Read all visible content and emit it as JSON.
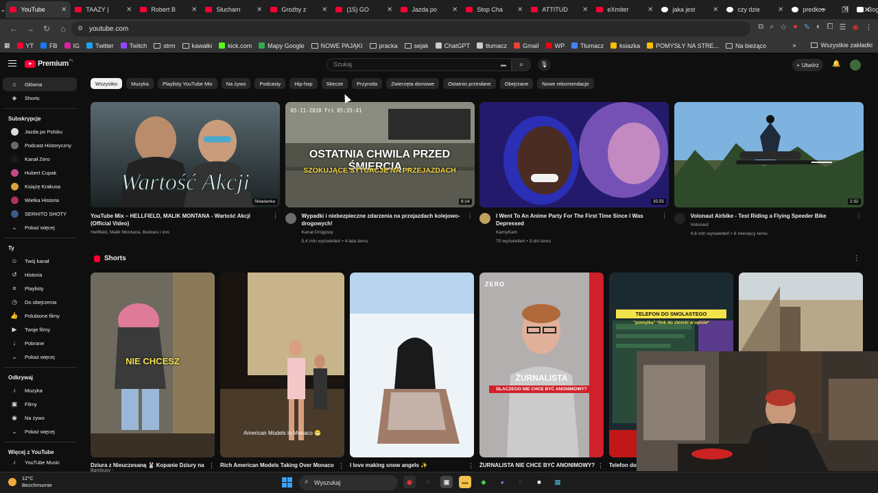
{
  "browser": {
    "tabs": [
      {
        "label": "YouTube",
        "icon": "youtube-icon",
        "active": true
      },
      {
        "label": "TAAZY |",
        "icon": "youtube-icon"
      },
      {
        "label": "Robert B",
        "icon": "youtube-icon"
      },
      {
        "label": "Słucham",
        "icon": "youtube-icon"
      },
      {
        "label": "Groźby z",
        "icon": "youtube-icon"
      },
      {
        "label": "(15) GO",
        "icon": "youtube-icon"
      },
      {
        "label": "Jazda po",
        "icon": "youtube-icon"
      },
      {
        "label": "Stop Cha",
        "icon": "youtube-icon"
      },
      {
        "label": "ATTITUD",
        "icon": "youtube-icon"
      },
      {
        "label": "eXmiter",
        "icon": "youtube-icon"
      },
      {
        "label": "jaka jest",
        "icon": "google-icon"
      },
      {
        "label": "czy dzie",
        "icon": "google-icon"
      },
      {
        "label": "predkos",
        "icon": "google-icon"
      },
      {
        "label": "Bogdan",
        "icon": "wikipedia-icon"
      }
    ],
    "new_tab": "+",
    "url": "youtube.com",
    "bookmarks": [
      {
        "label": "YT",
        "color": "#ff0033"
      },
      {
        "label": "FB",
        "color": "#1877f2"
      },
      {
        "label": "IG",
        "color": "#d6249f"
      },
      {
        "label": "Twitter",
        "color": "#1da1f2"
      },
      {
        "label": "Twitch",
        "color": "#9146ff"
      },
      {
        "label": "strm",
        "folder": true
      },
      {
        "label": "kawałki",
        "folder": true
      },
      {
        "label": "kick.com",
        "color": "#53fc18"
      },
      {
        "label": "Mapy Google",
        "color": "#34a853"
      },
      {
        "label": "NOWE PAJĄKI",
        "folder": true
      },
      {
        "label": "pracka",
        "folder": true
      },
      {
        "label": "sejak",
        "folder": true
      },
      {
        "label": "ChatGPT",
        "color": "#cccccc"
      },
      {
        "label": "tłumacz",
        "color": "#cccccc"
      },
      {
        "label": "Gmail",
        "color": "#ea4335"
      },
      {
        "label": "WP",
        "color": "#e30613"
      },
      {
        "label": "Tłumacz",
        "color": "#4285f4"
      },
      {
        "label": "ksiazka",
        "color": "#fbbc04"
      },
      {
        "label": "POMYSŁY NA STRE...",
        "color": "#fbbc04"
      },
      {
        "label": "Na bieżąco",
        "folder": true
      }
    ],
    "all_bookmarks": "Wszystkie zakładki"
  },
  "yt": {
    "logo_text": "Premium",
    "logo_region": "PL",
    "search_placeholder": "Szukaj",
    "create_label": "Utwórz",
    "sidebar": {
      "main": [
        {
          "label": "Główna",
          "icon": "home-icon",
          "active": true
        },
        {
          "label": "Shorts",
          "icon": "shorts-icon"
        }
      ],
      "subs_header": "Subskrypcje",
      "subs": [
        {
          "label": "Jazda po Polsku",
          "color": "#dddddd"
        },
        {
          "label": "Podcast Historyczny",
          "color": "#6b6b6b"
        },
        {
          "label": "Kanał Zero",
          "color": "#1a1a1a"
        },
        {
          "label": "Hubert Cupak",
          "color": "#c44b8a"
        },
        {
          "label": "Książę Krakusa",
          "color": "#d9a13b"
        },
        {
          "label": "Wielka Historia",
          "color": "#b03060"
        },
        {
          "label": "SERHITO SHOTY",
          "color": "#3b5b8a"
        }
      ],
      "more1": "Pokaż więcej",
      "you_header": "Ty",
      "you": [
        {
          "label": "Twój kanał",
          "icon": "user-icon"
        },
        {
          "label": "Historia",
          "icon": "history-icon"
        },
        {
          "label": "Playlisty",
          "icon": "playlist-icon"
        },
        {
          "label": "Do obejrzenia",
          "icon": "clock-icon"
        },
        {
          "label": "Polubione filmy",
          "icon": "like-icon"
        },
        {
          "label": "Twoje filmy",
          "icon": "video-icon"
        },
        {
          "label": "Pobrane",
          "icon": "download-icon"
        },
        {
          "label": "Pokaż więcej",
          "icon": "chevron-down-icon"
        }
      ],
      "explore_header": "Odkrywaj",
      "explore": [
        {
          "label": "Muzyka",
          "icon": "music-icon"
        },
        {
          "label": "Filmy",
          "icon": "film-icon"
        },
        {
          "label": "Na żywo",
          "icon": "live-icon"
        },
        {
          "label": "Pokaż więcej",
          "icon": "chevron-down-icon"
        }
      ],
      "more_yt_header": "Więcej z YouTube",
      "more_yt_item": "YouTube Music"
    },
    "chips": [
      "Wszystko",
      "Muzyka",
      "Playlisty YouTube Mix",
      "Na żywo",
      "Podcasty",
      "Hip-hop",
      "Skecze",
      "Przyroda",
      "Zwierzęta domowe",
      "Ostatnio przesłane",
      "Obejrzane",
      "Nowe rekomendacje"
    ],
    "videos": [
      {
        "title": "YouTube Mix – HELLFIELD, MALIK MONTANA - Wartość Akcji (Official Video)",
        "channel": "Hellfield, Malik Montana, Bedoes i inni",
        "stats": "",
        "duration": "Składanka",
        "thumb_text": "Wartość Akcji",
        "avatar": false
      },
      {
        "title": "Wypadki i niebezpieczne zdarzenia na przejazdach kolejowo-drogowych!",
        "channel": "Kanał Drogowy",
        "stats": "5,4 mln wyświetleń • 4 lata temu",
        "duration": "8:14",
        "thumb_text": "OSTATNIA CHWILA PRZED ŚMIERCIĄ...",
        "thumb_text2": "SZOKUJĄCE SYTUACJE NA PRZEJAZDACH",
        "thumb_stamp": "05-11-2018 Fri 05:35:41",
        "avatar": true
      },
      {
        "title": "I Went To An Anime Party For The First Time Since I Was Depressed",
        "channel": "KamyKam",
        "stats": "70 wyświetleń • 3 dni temu",
        "duration": "35:55",
        "avatar": true
      },
      {
        "title": "Volonaut Airbike - Test Riding a Flying Speeder Bike",
        "channel": "Volonaut",
        "stats": "4,6 mln wyświetleń • 8 miesięcy temu",
        "duration": "2:32",
        "avatar": true
      }
    ],
    "shorts_header": "Shorts",
    "shorts": [
      {
        "title": "Dziura z Nieuczesaną 🐰 Kopanie Dziury na",
        "sub": "Bambusy - ",
        "caption": "NIE CHCESZ"
      },
      {
        "title": "Rich American Models Taking Over Monaco",
        "sub": "",
        "caption": "American Models in Monaco 😁"
      },
      {
        "title": "I love making snow angels ✨",
        "sub": "",
        "caption": ""
      },
      {
        "title": "ŻURNALISTA NIE CHCE BYĆ ANONIMOWY?",
        "sub": "",
        "caption": "ŻURNALISTA",
        "caption2": "DLACZEGO NIE CHCE BYĆ ANONIMOWY?",
        "brand": "ZERO"
      },
      {
        "title": "Telefon do",
        "sub": "",
        "caption": "TELEFON DO SMOLASTEGO",
        "caption2": "\"pomyłka\" *link do zbiórki w opisie*"
      },
      {
        "title": "",
        "sub": "",
        "caption": ""
      }
    ]
  },
  "taskbar": {
    "temp": "12°C",
    "weather": "Bezchmurnie",
    "search": "Wyszukaj"
  }
}
